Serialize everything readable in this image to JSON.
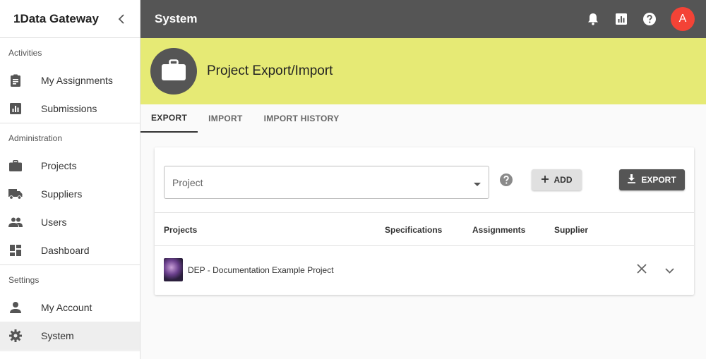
{
  "sidebar": {
    "title": "1Data Gateway",
    "sections": {
      "activities": "Activities",
      "administration": "Administration",
      "settings": "Settings"
    },
    "items": {
      "my_assignments": "My Assignments",
      "submissions": "Submissions",
      "projects": "Projects",
      "suppliers": "Suppliers",
      "users": "Users",
      "dashboard": "Dashboard",
      "my_account": "My Account",
      "system": "System"
    }
  },
  "topbar": {
    "title": "System",
    "avatar_initial": "A"
  },
  "banner": {
    "title": "Project Export/Import"
  },
  "tabs": [
    "EXPORT",
    "IMPORT",
    "IMPORT HISTORY"
  ],
  "form": {
    "project_placeholder": "Project",
    "add_label": "ADD",
    "export_label": "EXPORT"
  },
  "table": {
    "headers": {
      "projects": "Projects",
      "specifications": "Specifications",
      "assignments": "Assignments",
      "supplier": "Supplier"
    },
    "rows": [
      {
        "name": "DEP - Documentation Example Project"
      }
    ]
  },
  "colors": {
    "topbar": "#555555",
    "banner": "#e6ea75",
    "avatar": "#f44336"
  }
}
